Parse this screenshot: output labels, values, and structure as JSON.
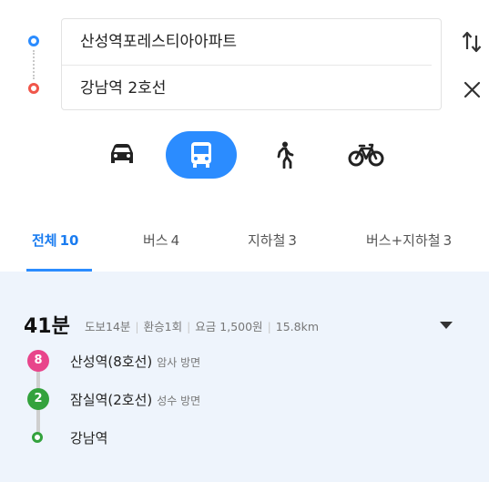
{
  "search": {
    "origin": "산성역포레스티아아파트",
    "destination": "강남역 2호선"
  },
  "modes": [
    "car",
    "bus",
    "walk",
    "bike"
  ],
  "active_mode": "bus",
  "tabs": [
    {
      "label": "전체",
      "count": "10"
    },
    {
      "label": "버스",
      "count": "4"
    },
    {
      "label": "지하철",
      "count": "3"
    },
    {
      "label": "버스+지하철",
      "count": "3"
    }
  ],
  "route": {
    "duration": "41분",
    "walk": "도보14분",
    "transfers": "환승1회",
    "fare": "요금 1,500원",
    "distance": "15.8km",
    "steps": [
      {
        "line": "8",
        "line_color": "#e8458b",
        "station": "산성역(8호선)",
        "direction": "암사 방면"
      },
      {
        "line": "2",
        "line_color": "#33a23d",
        "station": "잠실역(2호선)",
        "direction": "성수 방면"
      },
      {
        "station": "강남역"
      }
    ]
  },
  "colors": {
    "accent": "#2b8cff",
    "origin_marker": "#2b8cff",
    "destination_marker": "#f0564a",
    "card_background": "#eef4fc"
  }
}
